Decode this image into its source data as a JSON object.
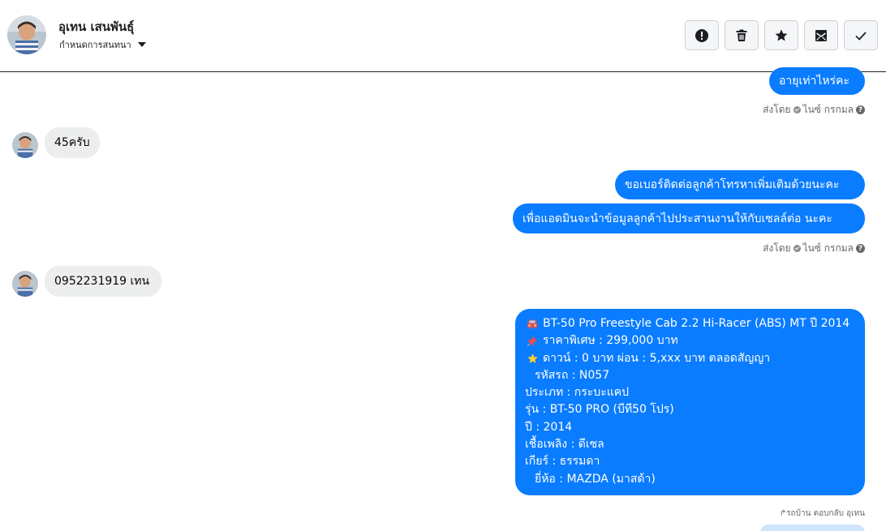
{
  "header": {
    "name": "อุเทน เสนพันธุ์",
    "subtitle": "กำหนดการสนทนา"
  },
  "actions": [
    {
      "icon": "alert-icon"
    },
    {
      "icon": "trash-icon"
    },
    {
      "icon": "star-icon"
    },
    {
      "icon": "unread-mail-icon"
    },
    {
      "icon": "check-icon"
    }
  ],
  "messages": {
    "m1": "อายุเท่าไหร่คะ",
    "sent_by_1": "ส่งโดย",
    "sent_name_1": "ไนซ์ กรกมล",
    "m2": "45ครับ",
    "m3": "ขอเบอร์ติดต่อลูกค้าโทรหาเพิ่มเติมด้วยนะคะ",
    "m4": "เพื่อแอดมินจะนำข้อมูลลูกค้าไปประสานงานให้กับเซลล์ต่อ นะคะ",
    "sent_by_2": "ส่งโดย",
    "sent_name_2": "ไนซ์ กรกมล",
    "m5": "0952231919 เทน",
    "reply_note": "รถบ้าน ตอบกลับ อุเทน"
  },
  "car": {
    "line1": "BT-50 Pro Freestyle Cab 2.2 Hi-Racer (ABS) MT ปี 2014",
    "line2": "ราคาพิเศษ : 299,000 บาท",
    "line3": "ดาวน์ : 0 บาท ผ่อน : 5,xxx บาท ตลอดสัญญา",
    "line4": "รหัสรถ : N057",
    "line5": "ประเภท : กระบะแคป",
    "line6": "รุ่น : BT-50 PRO (บีที50 โปร)",
    "line7": "ปี : 2014",
    "line8": "เชื้อเพลิง : ดีเซล",
    "line9": "เกียร์ : ธรรมดา",
    "line10": "ยี่ห้อ : MAZDA (มาสด้า)"
  },
  "colors": {
    "bubble_out": "#0a7cff",
    "bubble_in": "#eceded"
  }
}
